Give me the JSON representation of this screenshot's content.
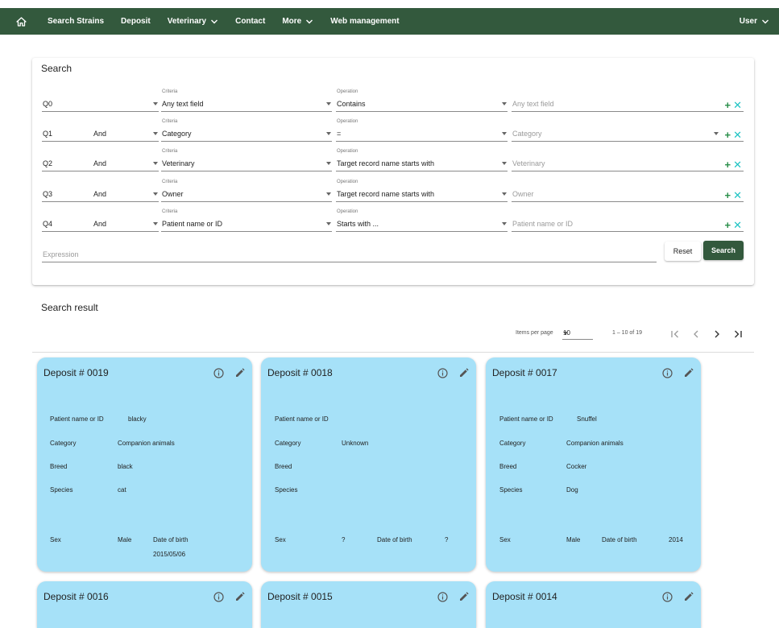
{
  "nav": {
    "items": [
      {
        "label": "Search Strains",
        "has_dropdown": false
      },
      {
        "label": "Deposit",
        "has_dropdown": false
      },
      {
        "label": "Veterinary",
        "has_dropdown": true
      },
      {
        "label": "Contact",
        "has_dropdown": false
      },
      {
        "label": "More",
        "has_dropdown": true
      },
      {
        "label": "Web management",
        "has_dropdown": false
      }
    ],
    "user_label": "User",
    "home_icon": "home-icon",
    "bg_color": "#33593d"
  },
  "search": {
    "title": "Search",
    "criteria_label": "Criteria",
    "operation_label": "Operation",
    "rows": [
      {
        "q": "Q0",
        "conj": "",
        "criteria": "Any text field",
        "operation": "Contains",
        "value_placeholder": "Any text field",
        "value_dropdown": false
      },
      {
        "q": "Q1",
        "conj": "And",
        "criteria": "Category",
        "operation": "=",
        "value_placeholder": "Category",
        "value_dropdown": true
      },
      {
        "q": "Q2",
        "conj": "And",
        "criteria": "Veterinary",
        "operation": "Target record name starts with",
        "value_placeholder": "Veterinary",
        "value_dropdown": false
      },
      {
        "q": "Q3",
        "conj": "And",
        "criteria": "Owner",
        "operation": "Target record name starts with",
        "value_placeholder": "Owner",
        "value_dropdown": false
      },
      {
        "q": "Q4",
        "conj": "And",
        "criteria": "Patient name or ID",
        "operation": "Starts with ...",
        "value_placeholder": "Patient name or ID",
        "value_dropdown": false
      }
    ],
    "add_symbol": "+",
    "remove_symbol": "✕",
    "expression_placeholder": "Expression",
    "reset_label": "Reset",
    "search_label": "Search"
  },
  "results": {
    "title": "Search result",
    "items_per_page_label": "Items per page",
    "items_per_page_value": "10",
    "range_label": "1 – 10 of 19"
  },
  "deposit_labels": {
    "patient": "Patient name or ID",
    "category": "Category",
    "breed": "Breed",
    "species": "Species",
    "sex": "Sex",
    "dob": "Date of birth"
  },
  "deposits": [
    {
      "title": "Deposit # 0019",
      "patient": "blacky",
      "category": "Companion animals",
      "breed": "black",
      "species": "cat",
      "sex": "Male",
      "dob": "2015/05/06"
    },
    {
      "title": "Deposit # 0018",
      "patient": "",
      "category": "Unknown",
      "breed": "",
      "species": "",
      "sex": "?",
      "dob": "?"
    },
    {
      "title": "Deposit # 0017",
      "patient": "Snuffel",
      "category": "Companion animals",
      "breed": "Cocker",
      "species": "Dog",
      "sex": "Male",
      "dob": "2014"
    },
    {
      "title": "Deposit # 0016"
    },
    {
      "title": "Deposit # 0015"
    },
    {
      "title": "Deposit # 0014"
    }
  ],
  "colors": {
    "card_bg": "#a6e1f8",
    "accent": "#33593d",
    "add": "#2a8f4a",
    "remove": "#1ec3c3"
  }
}
